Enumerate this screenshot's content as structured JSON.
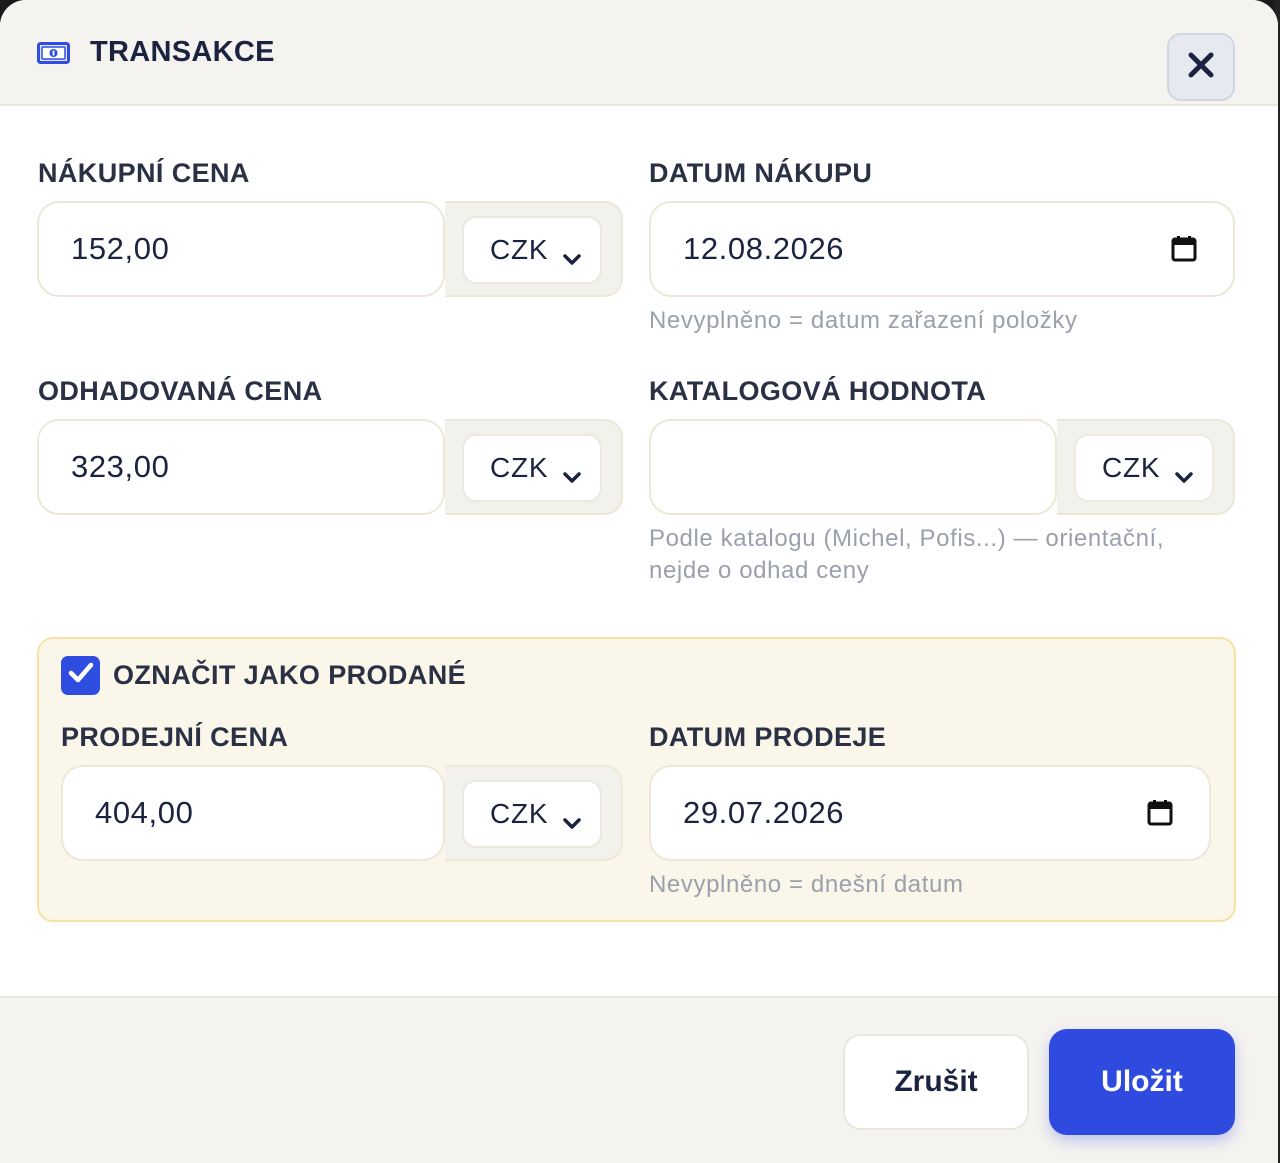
{
  "header": {
    "title": "TRANSAKCE",
    "icon": "banknote-icon",
    "close_icon": "close-icon"
  },
  "purchase_price": {
    "label": "NÁKUPNÍ CENA",
    "value": "152,00",
    "currency": "CZK"
  },
  "purchase_date": {
    "label": "DATUM NÁKUPU",
    "value": "12.08.2026",
    "hint": "Nevyplněno = datum zařazení položky"
  },
  "estimated_price": {
    "label": "ODHADOVANÁ CENA",
    "value": "323,00",
    "currency": "CZK"
  },
  "catalog_value": {
    "label": "KATALOGOVÁ HODNOTA",
    "value": "",
    "currency": "CZK",
    "hint_line1": "Podle katalogu (Michel, Pofis...) — orientační,",
    "hint_line2": "nejde o odhad ceny"
  },
  "sold": {
    "checkbox_label": "OZNAČIT JAKO PRODANÉ",
    "checked": true,
    "sale_price": {
      "label": "PRODEJNÍ CENA",
      "value": "404,00",
      "currency": "CZK"
    },
    "sale_date": {
      "label": "DATUM PRODEJE",
      "value": "29.07.2026",
      "hint": "Nevyplněno = dnešní datum"
    }
  },
  "footer": {
    "cancel_label": "Zrušit",
    "save_label": "Uložit"
  },
  "colors": {
    "accent": "#2f4ade",
    "sold_bg": "#fbf6ea",
    "sold_border": "#f6e3a3"
  }
}
